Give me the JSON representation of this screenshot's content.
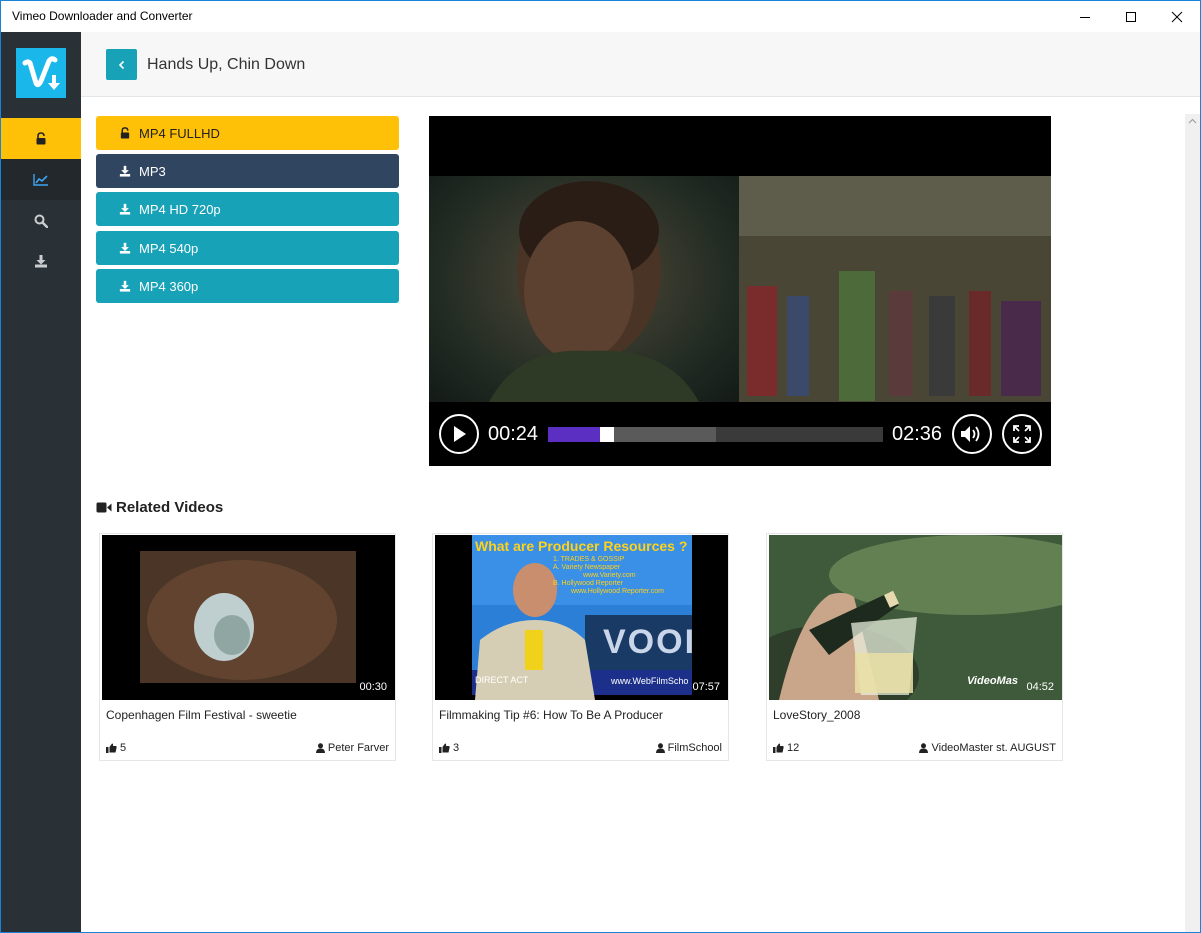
{
  "window": {
    "title": "Vimeo Downloader and Converter"
  },
  "sidebar": {
    "items": [
      {
        "name": "lock",
        "icon": "lock-icon"
      },
      {
        "name": "stats",
        "icon": "chart-icon"
      },
      {
        "name": "search",
        "icon": "search-icon"
      },
      {
        "name": "download",
        "icon": "download-icon"
      }
    ],
    "active_color": "#ffc107",
    "bg_color": "#2a3136"
  },
  "header": {
    "title": "Hands Up, Chin Down",
    "back_icon": "chevron-left-icon"
  },
  "formats": [
    {
      "label": "MP4 FULLHD",
      "icon": "lock-icon",
      "style": "gold"
    },
    {
      "label": "MP3",
      "icon": "download-icon",
      "style": "dark"
    },
    {
      "label": "MP4 HD 720p",
      "icon": "download-icon",
      "style": "teal"
    },
    {
      "label": "MP4 540p",
      "icon": "download-icon",
      "style": "teal"
    },
    {
      "label": "MP4 360p",
      "icon": "download-icon",
      "style": "teal"
    }
  ],
  "player": {
    "current_time": "00:24",
    "duration": "02:36",
    "progress_fraction": 0.154,
    "buffered_fraction": 0.5
  },
  "related": {
    "heading": "Related Videos",
    "heading_icon": "video-camera-icon",
    "videos": [
      {
        "title": "Copenhagen Film Festival - sweetie",
        "duration": "00:30",
        "likes": "5",
        "author": "Peter Farver"
      },
      {
        "title": "Filmmaking Tip #6: How To Be A Producer",
        "duration": "07:57",
        "likes": "3",
        "author": "FilmSchool"
      },
      {
        "title": "LoveStory_2008",
        "duration": "04:52",
        "likes": "12",
        "author": "VideoMaster st. AUGUST"
      }
    ]
  },
  "thumb_text": {
    "producer_headline": "What are Producer Resources ?",
    "producer_lines": [
      "1. TRADES & GOSSIP",
      "A. Variety Newspaper",
      "www.Variety.com",
      "B. Hollywood Reporter",
      "www.Hollywood Reporter.com"
    ],
    "producer_url": "www.WebFilmScho",
    "producer_logo": "VOOI",
    "producer_ticker": "DIRECT  ACT",
    "lovestory_watermark": "VideoMas"
  }
}
